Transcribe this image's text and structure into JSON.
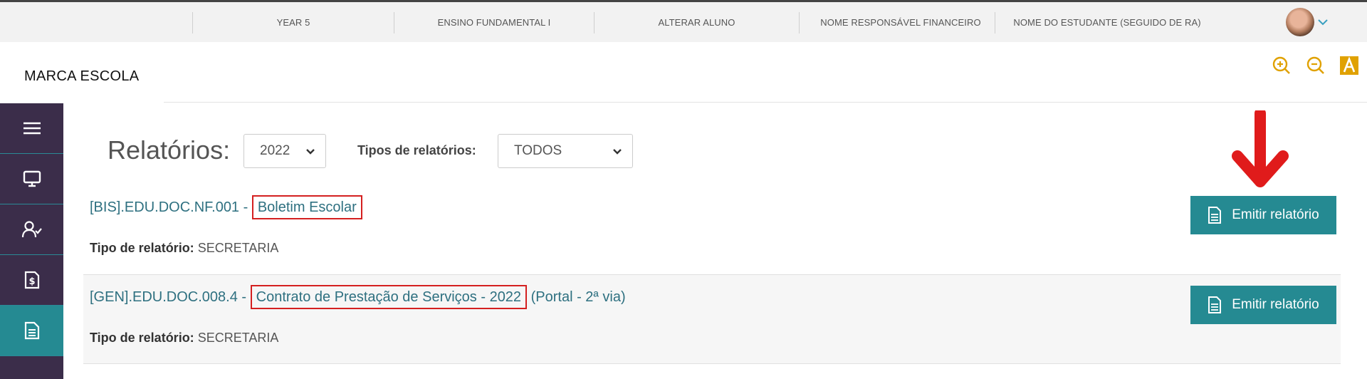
{
  "topnav": {
    "items": [
      "YEAR 5",
      "ENSINO FUNDAMENTAL I",
      "ALTERAR ALUNO",
      "NOME RESPONSÁVEL FINANCEIRO",
      "NOME DO ESTUDANTE (SEGUIDO DE RA)"
    ]
  },
  "brand": "MARCA ESCOLA",
  "tools": {
    "zoom_in_icon": "zoom-in-icon",
    "zoom_out_icon": "zoom-out-icon",
    "font_icon": "font-size-icon",
    "accent": "#e0a100"
  },
  "sidebar": {
    "items": [
      {
        "icon": "menu-icon"
      },
      {
        "icon": "monitor-icon"
      },
      {
        "icon": "user-check-icon"
      },
      {
        "icon": "money-document-icon"
      },
      {
        "icon": "report-document-icon",
        "active": true
      }
    ]
  },
  "reports": {
    "title": "Relatórios:",
    "year_selected": "2022",
    "types_label": "Tipos de relatórios:",
    "type_selected": "TODOS",
    "items": [
      {
        "code": "[BIS].EDU.DOC.NF.001 -",
        "name": "Boletim Escolar",
        "suffix": "",
        "type_label": "Tipo de relatório:",
        "type_value": "SECRETARIA",
        "button": "Emitir relatório"
      },
      {
        "code": "[GEN].EDU.DOC.008.4 -",
        "name": "Contrato de Prestação de Serviços - 2022",
        "suffix": "(Portal - 2ª via)",
        "type_label": "Tipo de relatório:",
        "type_value": "SECRETARIA",
        "button": "Emitir relatório"
      }
    ]
  },
  "colors": {
    "sidebar_bg": "#3b2d4a",
    "primary": "#258a92",
    "link": "#2e7080",
    "highlight": "#d42020"
  }
}
